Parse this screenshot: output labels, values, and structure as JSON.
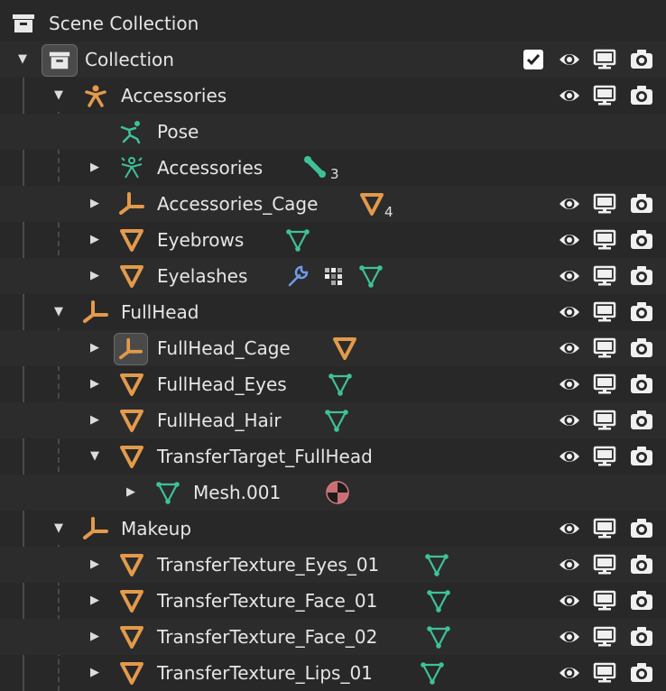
{
  "colors": {
    "background": "#282828",
    "text": "#e6e6e6",
    "orange": "#e39a4b",
    "green": "#3ec199",
    "blue": "#6f9be8",
    "pink": "#d27a7f"
  },
  "outliner": {
    "rows": [
      {
        "label": "Scene Collection",
        "icon": "scene-collection-icon"
      },
      {
        "label": "Collection",
        "icon": "collection-icon",
        "expanded": true,
        "checked": true
      },
      {
        "label": "Accessories",
        "icon": "armature-icon",
        "expanded": true
      },
      {
        "label": "Pose",
        "icon": "pose-icon"
      },
      {
        "label": "Accessories",
        "icon": "armature-data-icon",
        "extra": "bone-icon",
        "extra_count": "3"
      },
      {
        "label": "Accessories_Cage",
        "icon": "empty-icon",
        "extra": "mesh-modifier-icon",
        "extra_count": "4"
      },
      {
        "label": "Eyebrows",
        "icon": "mesh-object-icon",
        "extra": "mesh-data-icon"
      },
      {
        "label": "Eyelashes",
        "icon": "mesh-object-icon",
        "extra": "wrench-icon"
      },
      {
        "label": "FullHead",
        "icon": "empty-icon",
        "expanded": true
      },
      {
        "label": "FullHead_Cage",
        "icon": "empty-icon",
        "selected": true,
        "extra": "mesh-object-icon"
      },
      {
        "label": "FullHead_Eyes",
        "icon": "mesh-object-icon",
        "extra": "mesh-data-icon"
      },
      {
        "label": "FullHead_Hair",
        "icon": "mesh-object-icon",
        "extra": "mesh-data-icon"
      },
      {
        "label": "TransferTarget_FullHead",
        "icon": "mesh-object-icon",
        "expanded": true
      },
      {
        "label": "Mesh.001",
        "icon": "mesh-data-icon",
        "extra": "material-icon"
      },
      {
        "label": "Makeup",
        "icon": "empty-icon",
        "expanded": true
      },
      {
        "label": "TransferTexture_Eyes_01",
        "icon": "mesh-object-icon",
        "extra": "mesh-data-icon"
      },
      {
        "label": "TransferTexture_Face_01",
        "icon": "mesh-object-icon",
        "extra": "mesh-data-icon"
      },
      {
        "label": "TransferTexture_Face_02",
        "icon": "mesh-object-icon",
        "extra": "mesh-data-icon"
      },
      {
        "label": "TransferTexture_Lips_01",
        "icon": "mesh-object-icon",
        "extra": "mesh-data-icon"
      }
    ]
  }
}
